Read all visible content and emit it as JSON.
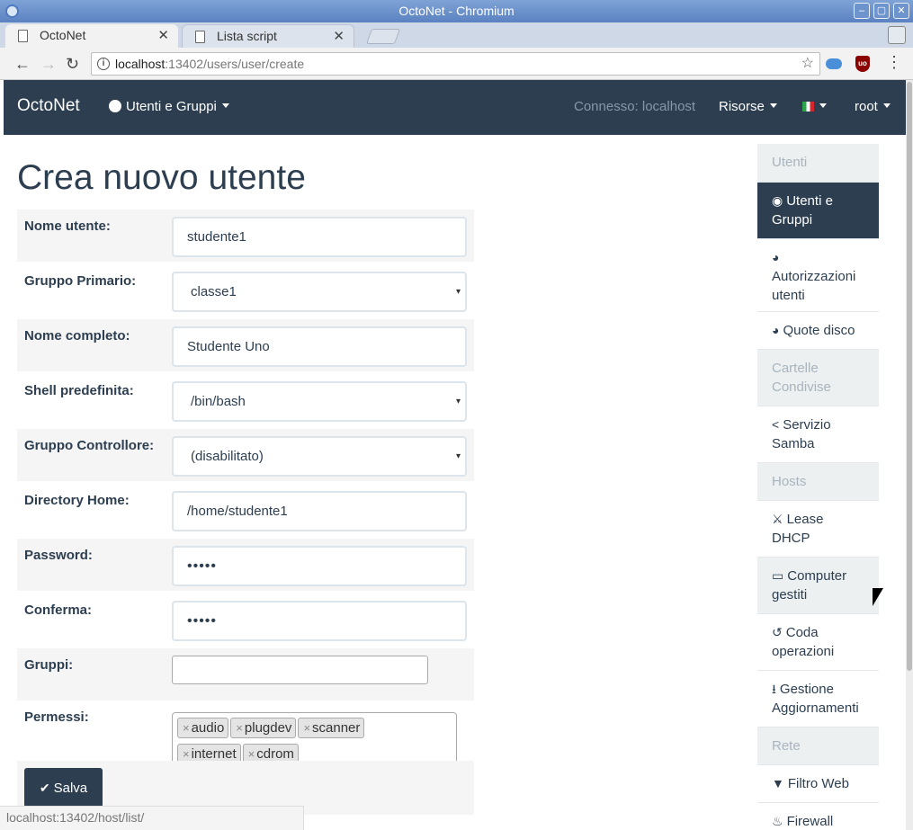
{
  "window": {
    "title": "OctoNet - Chromium",
    "controls": {
      "minimize": "–",
      "maximize": "▢",
      "close": "✕"
    }
  },
  "tabs": [
    {
      "title": "OctoNet",
      "close": "✕"
    },
    {
      "title": "Lista script",
      "close": "✕"
    }
  ],
  "address_bar": {
    "host": "localhost",
    "path": ":13402/users/user/create"
  },
  "icons": {
    "back": "←",
    "forward": "→",
    "reload": "↻",
    "info": "i",
    "star": "☆",
    "menu": "⋮",
    "caret": "caret-down",
    "ublock": "uo",
    "checkmark": "✔",
    "tag_remove": "×",
    "select_arrow": "▾"
  },
  "navbar": {
    "brand": "OctoNet",
    "users_menu": "Utenti e Gruppi",
    "connected": "Connesso: localhost",
    "resources": "Risorse",
    "language_flag": "italian-flag",
    "user": "root"
  },
  "page": {
    "title": "Crea nuovo utente"
  },
  "form": {
    "username": {
      "label": "Nome utente:",
      "value": "studente1"
    },
    "primary_group": {
      "label": "Gruppo Primario:",
      "value": "classe1"
    },
    "full_name": {
      "label": "Nome completo:",
      "value": "Studente Uno"
    },
    "shell": {
      "label": "Shell predefinita:",
      "value": "/bin/bash"
    },
    "controller_group": {
      "label": "Gruppo Controllore:",
      "value": "(disabilitato)"
    },
    "home_dir": {
      "label": "Directory Home:",
      "value": "/home/studente1"
    },
    "password": {
      "label": "Password:",
      "value": "•••••"
    },
    "confirm": {
      "label": "Conferma:",
      "value": "•••••"
    },
    "groups": {
      "label": "Gruppi:",
      "value": ""
    },
    "permissions": {
      "label": "Permessi:",
      "tags": [
        "audio",
        "plugdev",
        "scanner",
        "internet",
        "cdrom"
      ]
    },
    "save_label": "Salva"
  },
  "sidebar": {
    "items": [
      {
        "label": "Utenti",
        "type": "header"
      },
      {
        "label": "Utenti e Gruppi",
        "type": "active",
        "icon": "user-circle-icon",
        "glyph": "◉"
      },
      {
        "label": "Autorizzazioni utenti",
        "type": "item",
        "icon": "pie-chart-icon",
        "glyph": "◕"
      },
      {
        "label": "Quote disco",
        "type": "item",
        "icon": "pie-chart-icon",
        "glyph": "◕"
      },
      {
        "label": "Cartelle Condivise",
        "type": "header"
      },
      {
        "label": "Servizio Samba",
        "type": "item",
        "icon": "share-icon",
        "glyph": "<"
      },
      {
        "label": "Hosts",
        "type": "header"
      },
      {
        "label": "Lease DHCP",
        "type": "item",
        "icon": "handshake-icon",
        "glyph": "⚔"
      },
      {
        "label": "Computer gestiti",
        "type": "hover",
        "icon": "desktop-icon",
        "glyph": "▭"
      },
      {
        "label": "Coda operazioni",
        "type": "item",
        "icon": "history-icon",
        "glyph": "↺"
      },
      {
        "label": "Gestione Aggiornamenti",
        "type": "item",
        "icon": "download-icon",
        "glyph": "⭳"
      },
      {
        "label": "Rete",
        "type": "header"
      },
      {
        "label": "Filtro Web",
        "type": "item",
        "icon": "filter-icon",
        "glyph": "▼"
      },
      {
        "label": "Firewall",
        "type": "item",
        "icon": "fire-icon",
        "glyph": "♨"
      }
    ]
  },
  "status_bar": {
    "url": "localhost:13402/host/list/"
  }
}
